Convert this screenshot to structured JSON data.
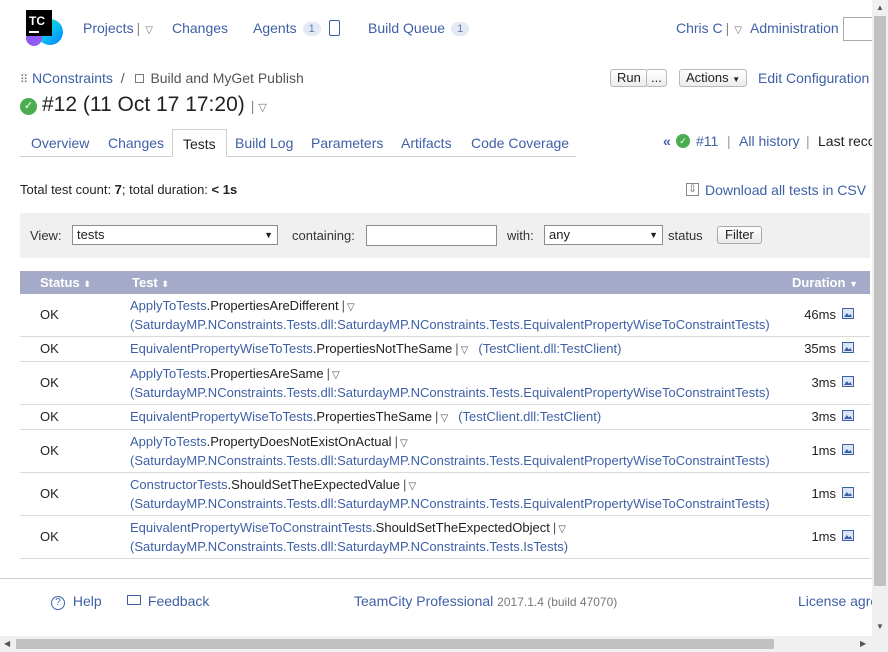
{
  "header": {
    "logo_text": "TC",
    "nav": {
      "projects": "Projects",
      "changes": "Changes",
      "agents": "Agents",
      "agents_count": "1",
      "build_queue": "Build Queue",
      "build_queue_count": "1",
      "user": "Chris C",
      "administration": "Administration"
    }
  },
  "breadcrumb": {
    "project": "NConstraints",
    "separator": "/",
    "build_config": "Build and MyGet Publish"
  },
  "toolbar": {
    "run": "Run",
    "run_more": "...",
    "actions": "Actions",
    "edit_config": "Edit Configuration S"
  },
  "build": {
    "title": "#12 (11 Oct 17 17:20)"
  },
  "tabs": [
    "Overview",
    "Changes",
    "Tests",
    "Build Log",
    "Parameters",
    "Artifacts",
    "Code Coverage"
  ],
  "active_tab": "Tests",
  "history": {
    "prev_build": "#11",
    "all_history": "All history",
    "last_recorded": "Last reco"
  },
  "summary": {
    "prefix": "Total test count: ",
    "count": "7",
    "middle": "; total duration: ",
    "duration": "< 1s"
  },
  "download_csv": "Download all tests in CSV",
  "filter": {
    "view_label": "View:",
    "view_value": "tests",
    "containing_label": "containing:",
    "containing_value": "",
    "with_label": "with:",
    "with_value": "any",
    "status_label": "status",
    "filter_button": "Filter"
  },
  "table": {
    "headers": {
      "status": "Status",
      "test": "Test",
      "duration": "Duration"
    },
    "rows": [
      {
        "status": "OK",
        "class": "ApplyToTests",
        "method": ".PropertiesAreDifferent",
        "suite": "SaturdayMP.NConstraints.Tests.dll:SaturdayMP.NConstraints.Tests.EquivalentPropertyWiseToConstraintTests",
        "duration": "46ms"
      },
      {
        "status": "OK",
        "class": "EquivalentPropertyWiseToTests",
        "method": ".PropertiesNotTheSame",
        "suite": "TestClient.dll:TestClient",
        "duration": "35ms"
      },
      {
        "status": "OK",
        "class": "ApplyToTests",
        "method": ".PropertiesAreSame",
        "suite": "SaturdayMP.NConstraints.Tests.dll:SaturdayMP.NConstraints.Tests.EquivalentPropertyWiseToConstraintTests",
        "duration": "3ms"
      },
      {
        "status": "OK",
        "class": "EquivalentPropertyWiseToTests",
        "method": ".PropertiesTheSame",
        "suite": "TestClient.dll:TestClient",
        "duration": "3ms"
      },
      {
        "status": "OK",
        "class": "ApplyToTests",
        "method": ".PropertyDoesNotExistOnActual",
        "suite": "SaturdayMP.NConstraints.Tests.dll:SaturdayMP.NConstraints.Tests.EquivalentPropertyWiseToConstraintTests",
        "duration": "1ms"
      },
      {
        "status": "OK",
        "class": "ConstructorTests",
        "method": ".ShouldSetTheExpectedValue",
        "suite": "SaturdayMP.NConstraints.Tests.dll:SaturdayMP.NConstraints.Tests.EquivalentPropertyWiseToConstraintTests",
        "duration": "1ms"
      },
      {
        "status": "OK",
        "class": "EquivalentPropertyWiseToConstraintTests",
        "method": ".ShouldSetTheExpectedObject",
        "suite": "SaturdayMP.NConstraints.Tests.dll:SaturdayMP.NConstraints.Tests.IsTests",
        "duration": "1ms"
      }
    ]
  },
  "footer": {
    "help": "Help",
    "feedback": "Feedback",
    "product": "TeamCity Professional",
    "version": "2017.1.4 (build 47070)",
    "license": "License agre"
  },
  "colors": {
    "link": "#3f60a6",
    "table_header": "#a4aac8",
    "success": "#4aad4f"
  }
}
